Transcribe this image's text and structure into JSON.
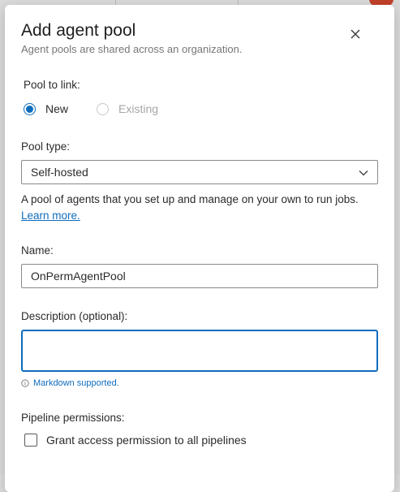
{
  "dialog": {
    "title": "Add agent pool",
    "subtitle": "Agent pools are shared across an organization."
  },
  "pool_to_link": {
    "label": "Pool to link:",
    "options": [
      {
        "label": "New",
        "selected": true,
        "disabled": false
      },
      {
        "label": "Existing",
        "selected": false,
        "disabled": true
      }
    ]
  },
  "pool_type": {
    "label": "Pool type:",
    "selected": "Self-hosted",
    "help_text": "A pool of agents that you set up and manage on your own to run jobs.",
    "learn_more": "Learn more."
  },
  "name": {
    "label": "Name:",
    "value": "OnPermAgentPool"
  },
  "description": {
    "label": "Description (optional):",
    "value": "",
    "hint": "Markdown supported."
  },
  "pipeline_permissions": {
    "label": "Pipeline permissions:",
    "checkbox_label": "Grant access permission to all pipelines",
    "checked": false
  },
  "colors": {
    "accent": "#0f6cbd",
    "text": "#2b2b2b",
    "muted": "#767676"
  }
}
